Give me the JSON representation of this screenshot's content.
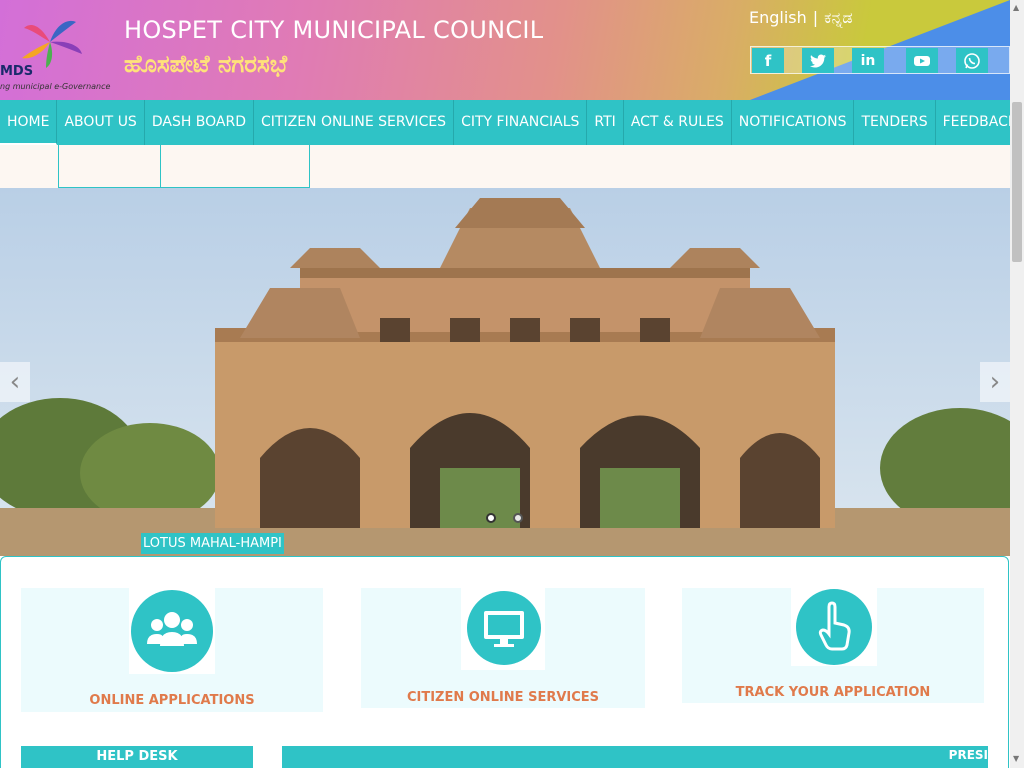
{
  "header": {
    "logo_text": "MDS",
    "logo_tagline": "ng municipal e-Governance",
    "title": "HOSPET CITY MUNICIPAL COUNCIL",
    "subtitle": "ಹೊಸಪೇಟೆ ನಗರಸಭೆ",
    "lang_english": "English",
    "lang_separator": "|",
    "lang_kannada": "ಕನ್ನಡ",
    "social": [
      {
        "icon": "facebook-icon",
        "glyph": "f"
      },
      {
        "icon": "twitter-icon",
        "glyph": "t"
      },
      {
        "icon": "linkedin-icon",
        "glyph": "in"
      },
      {
        "icon": "youtube-icon",
        "glyph": "▶"
      },
      {
        "icon": "whatsapp-icon",
        "glyph": "✆"
      }
    ]
  },
  "nav": {
    "items": [
      "HOME",
      "ABOUT US",
      "DASH BOARD",
      "CITIZEN ONLINE SERVICES",
      "CITY FINANCIALS",
      "RTI",
      "ACT & RULES",
      "NOTIFICATIONS",
      "TENDERS",
      "FEEDBACK"
    ]
  },
  "slider": {
    "caption": "LOTUS MAHAL-HAMPI",
    "prev_glyph": "‹",
    "next_glyph": "›"
  },
  "cards": [
    {
      "label": "ONLINE APPLICATIONS",
      "icon": "users-group-icon"
    },
    {
      "label": "CITIZEN ONLINE SERVICES",
      "icon": "monitor-icon"
    },
    {
      "label": "TRACK YOUR APPLICATION",
      "icon": "pointer-hand-icon"
    }
  ],
  "bottom": {
    "helpdesk": "HELP DESK",
    "presi": "PRESI"
  },
  "colors": {
    "accent": "#2fc3c6",
    "card_label": "#e07a4b",
    "subtitle": "#ffe27a"
  }
}
